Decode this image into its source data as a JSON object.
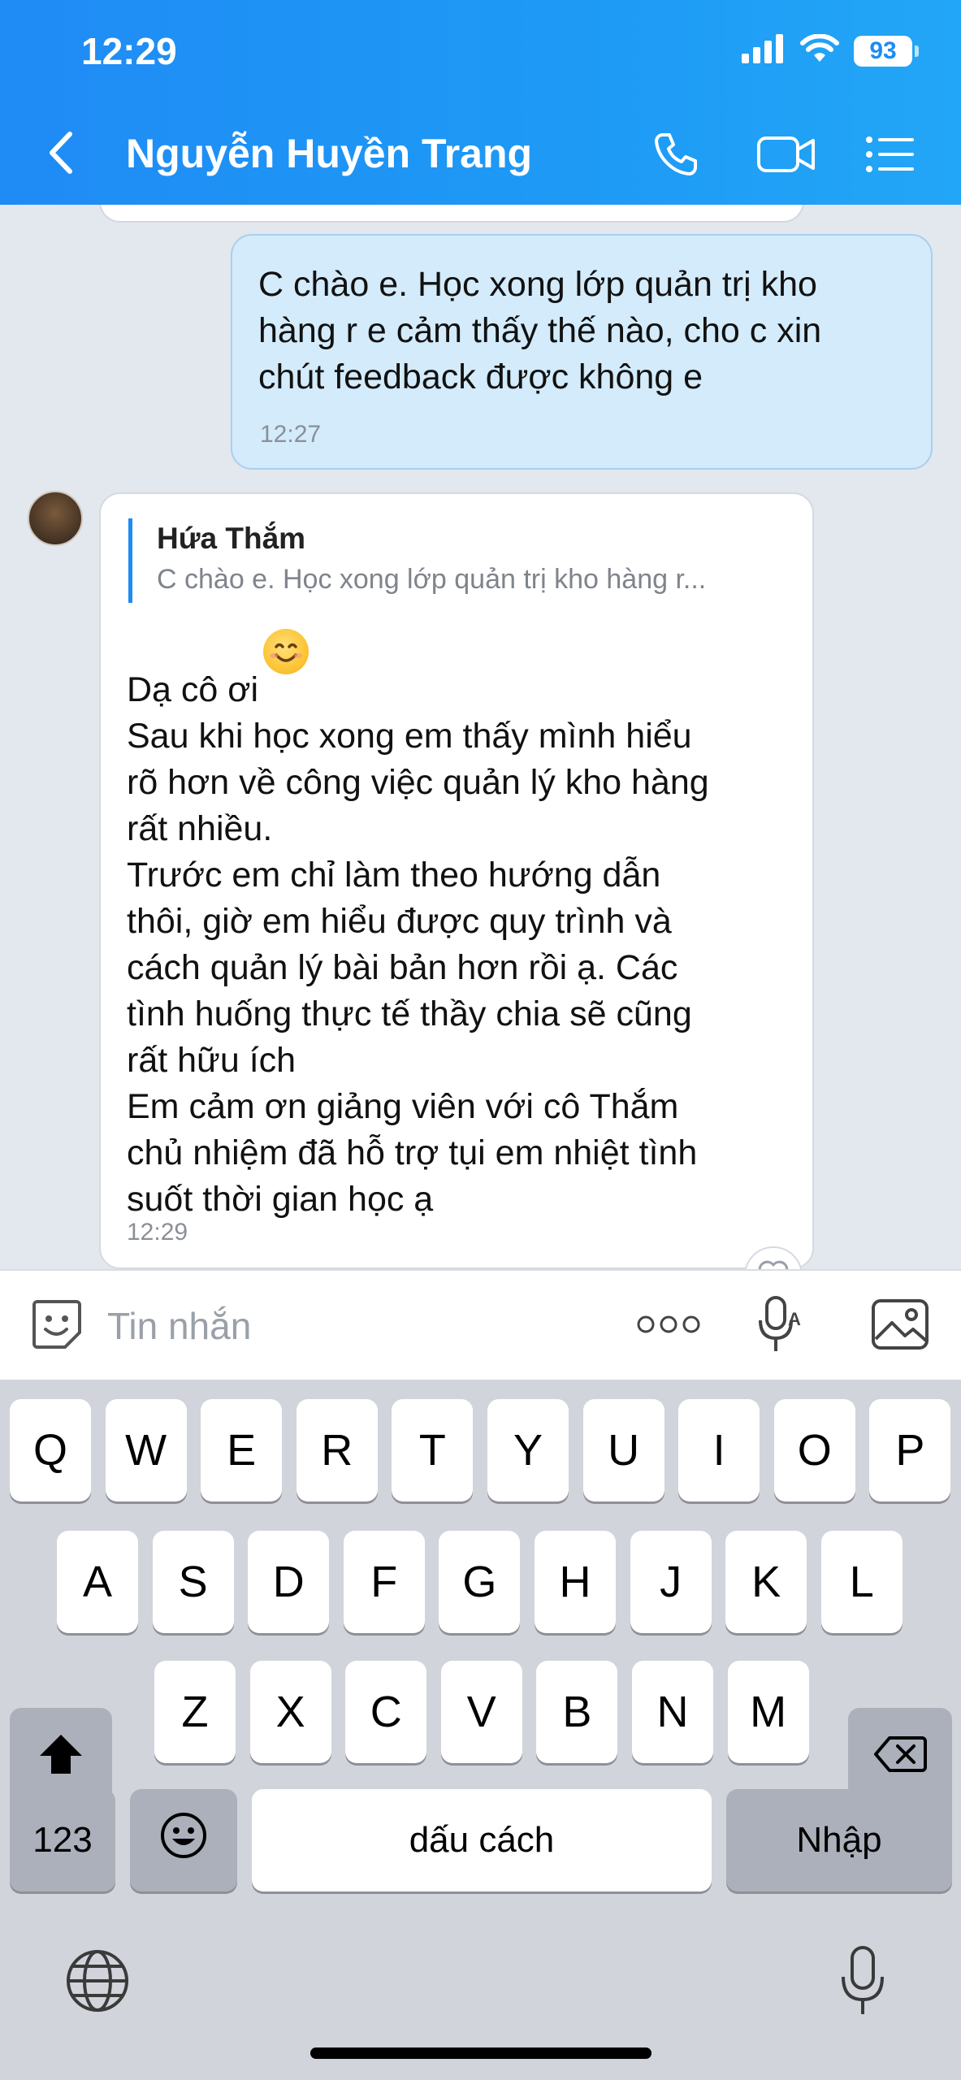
{
  "status_bar": {
    "time": "12:29",
    "battery": "93"
  },
  "header": {
    "contact_name": "Nguyễn Huyền Trang"
  },
  "messages": {
    "outgoing": {
      "text": "C chào e. Học xong lớp quản trị kho\nhàng r e cảm thấy thế nào, cho c xin\nchút feedback được không e",
      "time": "12:27"
    },
    "incoming": {
      "quote_author": "Hứa Thắm",
      "quote_text": "C chào e. Học xong lớp quản trị kho hàng r...",
      "line1": "Dạ cô ơi",
      "body": "Sau khi học xong em thấy mình hiểu\nrõ hơn về công việc quản lý kho hàng\nrất nhiều.\nTrước em chỉ làm theo hướng dẫn\nthôi, giờ em hiểu được quy trình và\ncách quản lý bài bản hơn rồi ạ. Các\ntình huống thực tế thầy chia sẽ cũng\nrất hữu ích\nEm cảm ơn giảng viên với cô Thắm\nchủ nhiệm đã hỗ trợ tụi em nhiệt tình\nsuốt thời gian học  ạ",
      "time": "12:29"
    }
  },
  "composer": {
    "placeholder": "Tin nhắn"
  },
  "keyboard": {
    "row1": [
      "Q",
      "W",
      "E",
      "R",
      "T",
      "Y",
      "U",
      "I",
      "O",
      "P"
    ],
    "row2": [
      "A",
      "S",
      "D",
      "F",
      "G",
      "H",
      "J",
      "K",
      "L"
    ],
    "row3": [
      "Z",
      "X",
      "C",
      "V",
      "B",
      "N",
      "M"
    ],
    "numbers_label": "123",
    "space_label": "dấu cách",
    "return_label": "Nhập"
  },
  "colors": {
    "header": "#1f8bf5",
    "outgoing_bubble": "#d3ebfb",
    "keyboard_bg": "#d1d4da"
  },
  "icons": [
    "back-icon",
    "phone-icon",
    "video-call-icon",
    "menu-list-icon",
    "sticker-icon",
    "more-icon",
    "voice-to-text-icon",
    "image-icon",
    "shift-icon",
    "backspace-icon",
    "emoji-icon",
    "globe-icon",
    "dictation-icon"
  ]
}
